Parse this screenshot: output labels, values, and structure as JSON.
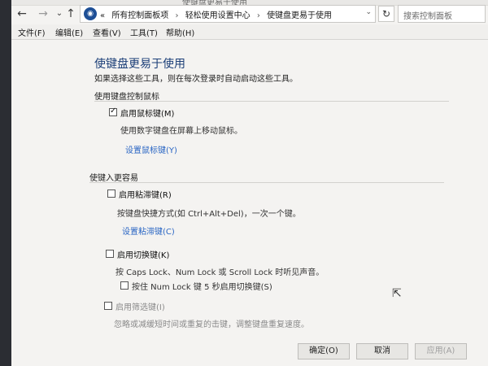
{
  "window": {
    "title": "使键盘更易于使用"
  },
  "nav": {
    "back_icon": "←",
    "forward_icon": "→",
    "dropdown_icon": "⌄",
    "up_icon": "↑"
  },
  "address": {
    "prefix": "«",
    "crumbs": [
      "所有控制面板项",
      "轻松使用设置中心",
      "使键盘更易于使用"
    ],
    "separator": "›",
    "dropdown": "⌄",
    "refresh_icon": "↻"
  },
  "search": {
    "placeholder": "搜索控制面板"
  },
  "menu": [
    "文件(F)",
    "编辑(E)",
    "查看(V)",
    "工具(T)",
    "帮助(H)"
  ],
  "page": {
    "title": "使键盘更易于使用",
    "subtitle": "如果选择这些工具，则在每次登录时自动启动这些工具。"
  },
  "mouse_section": {
    "heading": "使用键盘控制鼠标",
    "mouse_keys_label": "启用鼠标键(M)",
    "mouse_keys_checked": true,
    "mouse_keys_desc": "使用数字键盘在屏幕上移动鼠标。",
    "mouse_keys_link": "设置鼠标键(Y)"
  },
  "typing_section": {
    "heading": "使键入更容易",
    "sticky_label": "启用粘滞键(R)",
    "sticky_checked": false,
    "sticky_desc": "按键盘快捷方式(如 Ctrl+Alt+Del)，一次一个键。",
    "sticky_link": "设置粘滞键(C)",
    "toggle_label": "启用切换键(K)",
    "toggle_checked": false,
    "toggle_desc": "按 Caps Lock、Num Lock 或 Scroll Lock 时听见声音。",
    "toggle_hold_label": "按住 Num Lock 键 5 秒启用切换键(S)",
    "toggle_hold_checked": false,
    "filter_label": "启用筛选键(I)",
    "filter_checked": false,
    "filter_desc": "忽略或减缓短时间或重复的击键，调整键盘重复速度。"
  },
  "buttons": {
    "ok": "确定(O)",
    "cancel": "取消",
    "apply": "应用(A)"
  }
}
